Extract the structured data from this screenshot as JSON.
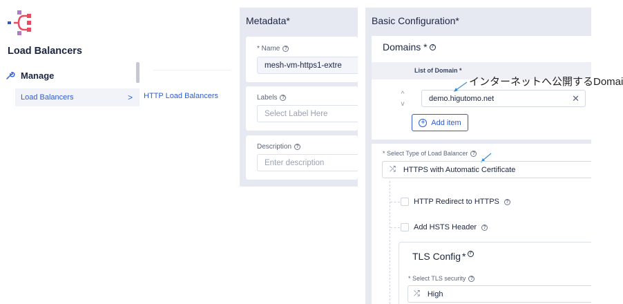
{
  "nav": {
    "title": "Load Balancers",
    "section": "Manage",
    "sub_item": "Load Balancers",
    "sub_item_chevron": ">",
    "page_link": "HTTP Load Balancers"
  },
  "metadata": {
    "title": "Metadata",
    "required_mark": "*",
    "name_label": "* Name",
    "name_value": "mesh-vm-https1-extre",
    "labels_label": "Labels",
    "labels_placeholder": "Select Label Here",
    "description_label": "Description",
    "description_placeholder": "Enter description"
  },
  "basic": {
    "title": "Basic Configuration",
    "required_mark": "*",
    "domains_title": "Domains *",
    "list_header": "List of Domain *",
    "domain_value": "demo.higutomo.net",
    "add_item": "Add item",
    "annotation": "インターネットへ公開するDomain",
    "lb_type_label": "* Select Type of Load Balancer",
    "lb_type_value": "HTTPS with Automatic Certificate",
    "http_redirect": "HTTP Redirect to HTTPS",
    "add_hsts": "Add HSTS Header",
    "tls_title": "TLS Config",
    "tls_required": "*",
    "tls_security_label": "* Select TLS security",
    "tls_security_value": "High"
  },
  "colors": {
    "accent": "#2f5bcc",
    "panel_bg": "#e6e9f2",
    "annotation_arrow": "#3a8fd0"
  }
}
